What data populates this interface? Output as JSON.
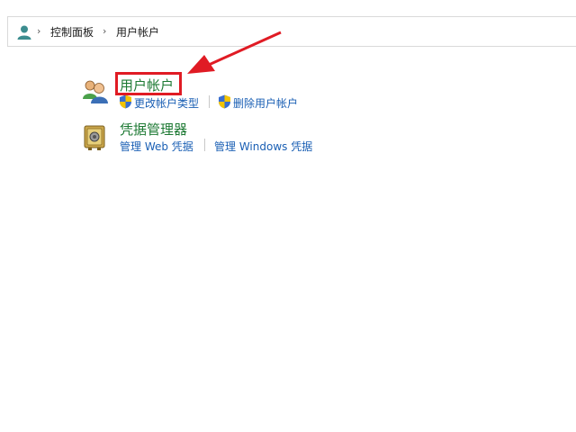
{
  "breadcrumb": {
    "icon": "user-accounts-icon",
    "items": [
      "控制面板",
      "用户帐户"
    ]
  },
  "categories": [
    {
      "title": "用户帐户",
      "icon": "users-icon",
      "links": [
        {
          "label": "更改帐户类型",
          "icon": "uac-shield-icon"
        },
        {
          "label": "删除用户帐户",
          "icon": "uac-shield-icon"
        }
      ]
    },
    {
      "title": "凭据管理器",
      "icon": "credential-vault-icon",
      "links": [
        {
          "label": "管理 Web 凭据"
        },
        {
          "label": "管理 Windows 凭据"
        }
      ]
    }
  ],
  "annotation": {
    "highlight_color": "#e01b24"
  },
  "colors": {
    "category_title": "#1e7a34",
    "link": "#1a5fb4"
  }
}
